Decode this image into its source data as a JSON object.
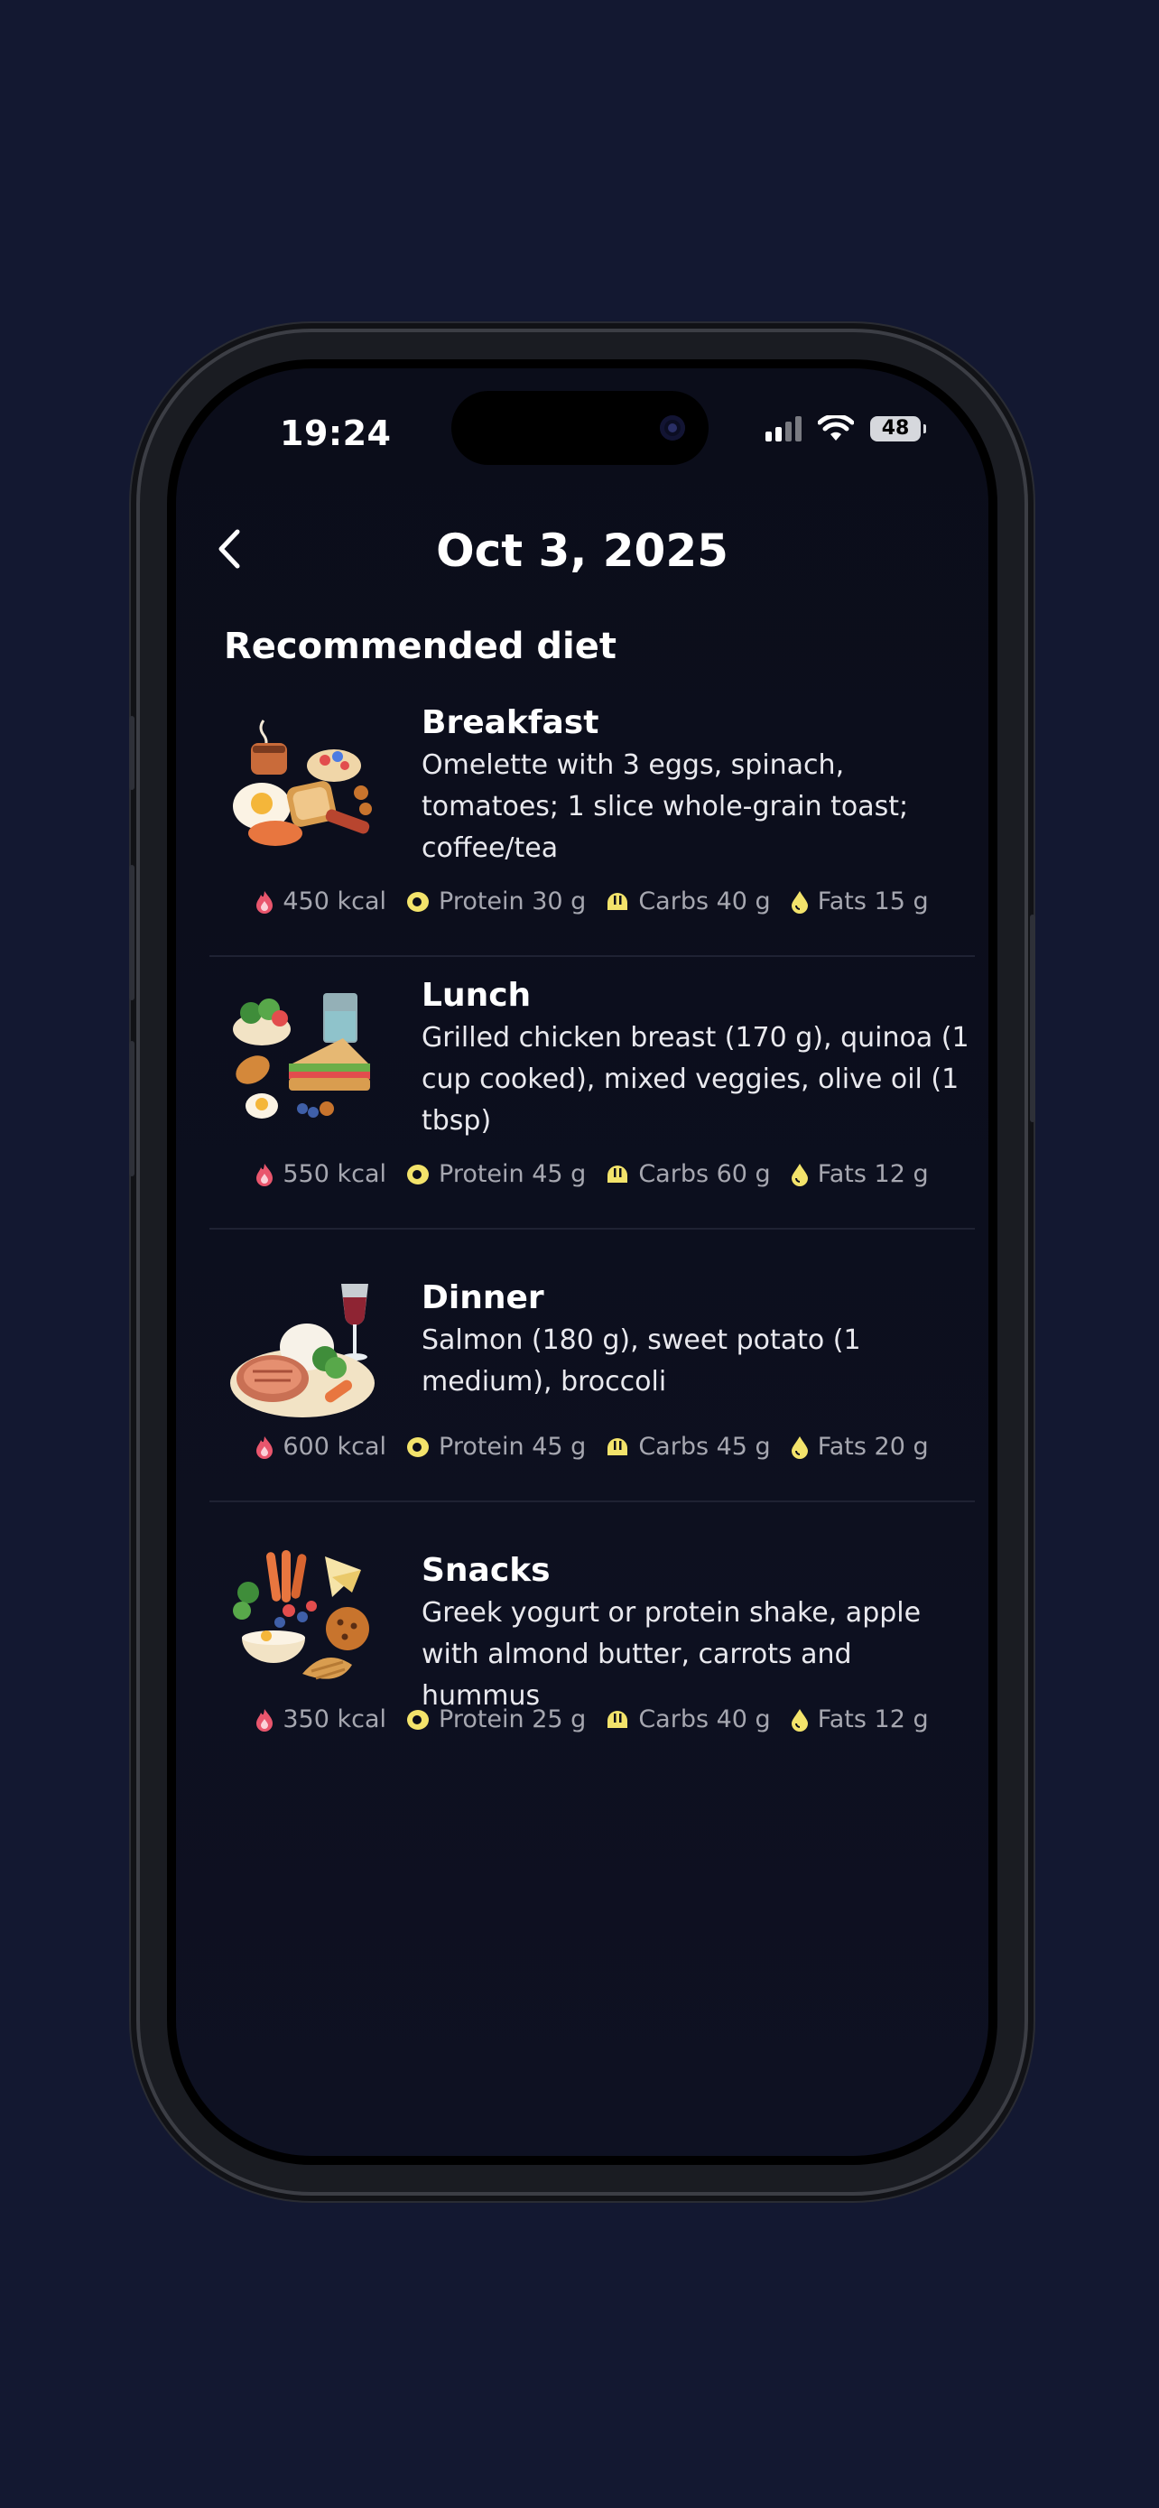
{
  "status_bar": {
    "time": "19:24",
    "battery": "48"
  },
  "nav": {
    "title": "Oct 3, 2025"
  },
  "section": {
    "title": "Recommended diet"
  },
  "meals": [
    {
      "name": "Breakfast",
      "description": "Omelette with 3 eggs, spinach, tomatoes; 1 slice whole-grain toast; coffee/tea",
      "kcal": "450 kcal",
      "protein": "Protein 30 g",
      "carbs": "Carbs 40 g",
      "fats": "Fats 15 g"
    },
    {
      "name": "Lunch",
      "description": "Grilled chicken breast (170 g), quinoa (1 cup cooked), mixed veggies, olive oil (1 tbsp)",
      "kcal": "550 kcal",
      "protein": "Protein 45 g",
      "carbs": "Carbs 60 g",
      "fats": "Fats 12 g"
    },
    {
      "name": "Dinner",
      "description": "Salmon (180 g), sweet potato (1 medium), broccoli",
      "kcal": "600 kcal",
      "protein": "Protein 45 g",
      "carbs": "Carbs 45 g",
      "fats": "Fats 20 g"
    },
    {
      "name": "Snacks",
      "description": "Greek yogurt or protein shake, apple with almond butter, carrots and hummus",
      "kcal": "350 kcal",
      "protein": "Protein 25 g",
      "carbs": "Carbs 40 g",
      "fats": "Fats 12 g"
    }
  ],
  "colors": {
    "background": "#131831",
    "screen": "#0b0d1a",
    "kcal_icon": "#e9566d",
    "macro_icon": "#f3e36b"
  },
  "icons": {
    "back": "chevron-left-icon",
    "kcal": "flame-icon",
    "protein": "egg-icon",
    "carbs": "bread-icon",
    "fats": "drop-icon"
  }
}
